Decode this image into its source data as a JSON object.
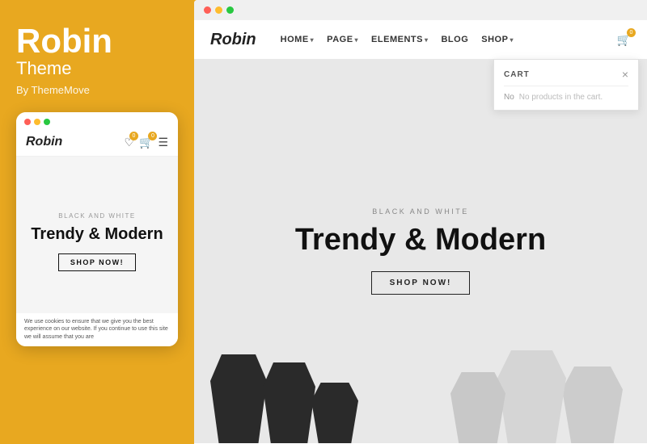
{
  "left": {
    "brand": {
      "title": "Robin",
      "subtitle": "Theme",
      "author": "By ThemeMove"
    },
    "mobile": {
      "logo": "Robin",
      "tag": "BLACK AND WHITE",
      "heading": "Trendy & Modern",
      "button_label": "SHOP NOW!",
      "cookie_text": "We use cookies to ensure that we give you the best experience on our website. If you continue to use this site we will assume that you are"
    }
  },
  "right": {
    "nav": {
      "logo": "Robin",
      "links": [
        {
          "label": "HOME",
          "has_dropdown": true
        },
        {
          "label": "PAGE",
          "has_dropdown": true
        },
        {
          "label": "ELEMENTS",
          "has_dropdown": true
        },
        {
          "label": "BLOG",
          "has_dropdown": false
        },
        {
          "label": "SHOP",
          "has_dropdown": true
        }
      ],
      "cart_label": "CART",
      "cart_empty": "No products in the cart."
    },
    "hero": {
      "tag": "BLACK AND WHITE",
      "heading": "Trendy & Modern",
      "button_label": "SHOP NOW!"
    }
  },
  "colors": {
    "accent": "#E8A820",
    "dark": "#111111",
    "white": "#ffffff"
  }
}
